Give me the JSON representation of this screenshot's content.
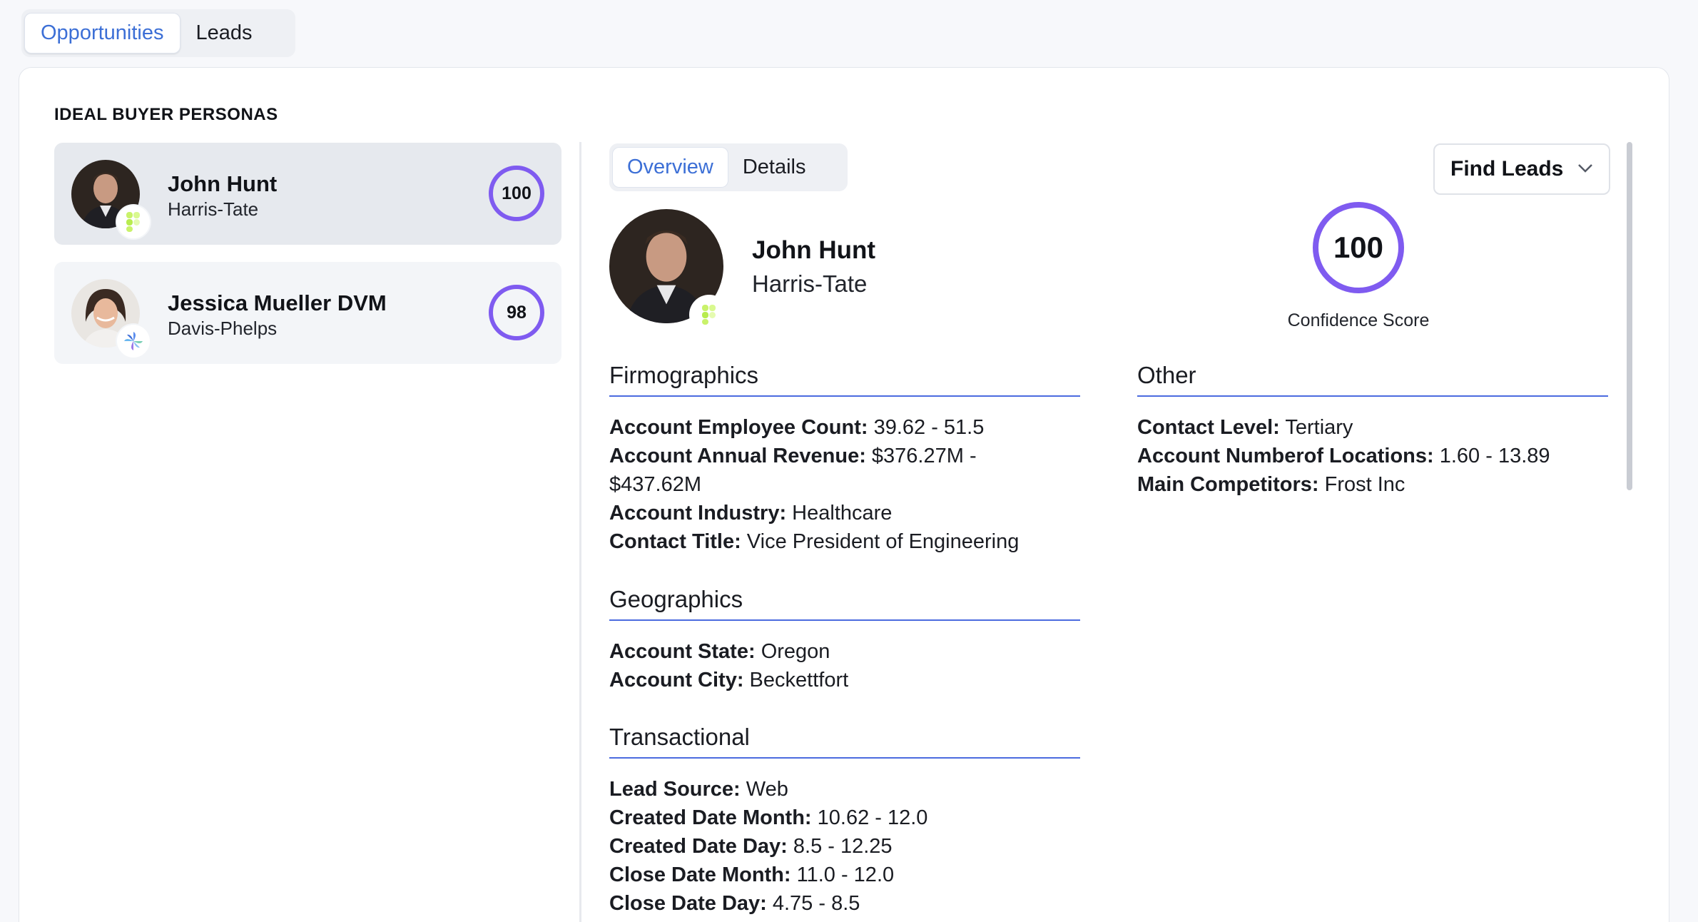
{
  "top_tabs": [
    {
      "label": "Opportunities",
      "active": true
    },
    {
      "label": "Leads",
      "active": false
    }
  ],
  "section_title": "IDEAL BUYER PERSONAS",
  "personas": [
    {
      "name": "John Hunt",
      "company": "Harris-Tate",
      "score": "100",
      "selected": true
    },
    {
      "name": "Jessica Mueller DVM",
      "company": "Davis-Phelps",
      "score": "98",
      "selected": false
    }
  ],
  "detail": {
    "tabs": [
      {
        "label": "Overview",
        "active": true
      },
      {
        "label": "Details",
        "active": false
      }
    ],
    "find_leads_label": "Find Leads",
    "name": "John Hunt",
    "company": "Harris-Tate",
    "confidence_score": "100",
    "confidence_label": "Confidence Score",
    "firmographics": {
      "title": "Firmographics",
      "fields": [
        {
          "key": "Account Employee Count:",
          "value": " 39.62 - 51.5"
        },
        {
          "key": "Account Annual Revenue:",
          "value": " $376.27M - $437.62M"
        },
        {
          "key": "Account Industry:",
          "value": " Healthcare"
        },
        {
          "key": "Contact Title:",
          "value": " Vice President of Engineering"
        }
      ]
    },
    "geographics": {
      "title": "Geographics",
      "fields": [
        {
          "key": "Account State:",
          "value": " Oregon"
        },
        {
          "key": "Account City:",
          "value": " Beckettfort"
        }
      ]
    },
    "transactional": {
      "title": "Transactional",
      "fields": [
        {
          "key": "Lead Source:",
          "value": " Web"
        },
        {
          "key": "Created Date Month:",
          "value": " 10.62 - 12.0"
        },
        {
          "key": "Created Date Day:",
          "value": " 8.5 - 12.25"
        },
        {
          "key": "Close Date Month:",
          "value": " 11.0 - 12.0"
        },
        {
          "key": "Close Date Day:",
          "value": " 4.75 - 8.5"
        }
      ]
    },
    "other": {
      "title": "Other",
      "fields": [
        {
          "key": "Contact Level:",
          "value": " Tertiary"
        },
        {
          "key": "Account Numberof Locations:",
          "value": " 1.60 - 13.89"
        },
        {
          "key": "Main Competitors:",
          "value": " Frost Inc"
        }
      ]
    }
  },
  "colors": {
    "accent_blue": "#3c6fd6",
    "score_ring": "#7f5bf0",
    "section_rule": "#4b6bdf"
  },
  "icons": {
    "company_logo_harris_tate": "figma-logo-icon",
    "company_logo_davis_phelps": "pinwheel-logo-icon",
    "dropdown": "chevron-down-icon"
  }
}
